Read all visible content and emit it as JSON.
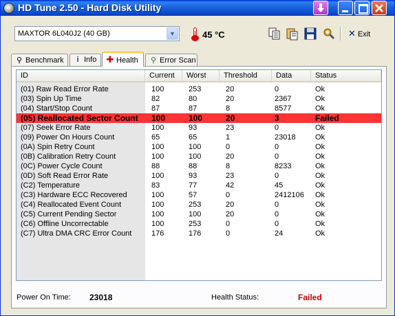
{
  "window": {
    "title": "HD Tune 2.50 - Hard Disk Utility"
  },
  "toolbar": {
    "drive": "MAXTOR 6L040J2 (40 GB)",
    "temperature": "45 °C",
    "exit_label": "Exit"
  },
  "tabs": [
    {
      "label": "Benchmark",
      "icon": "benchmark-icon"
    },
    {
      "label": "Info",
      "icon": "info-icon"
    },
    {
      "label": "Health",
      "icon": "health-cross-icon"
    },
    {
      "label": "Error Scan",
      "icon": "magnifier-icon"
    }
  ],
  "table": {
    "columns": [
      "ID",
      "Current",
      "Worst",
      "Threshold",
      "Data",
      "Status"
    ],
    "rows": [
      {
        "id": "(01) Raw Read Error Rate",
        "current": "100",
        "worst": "253",
        "threshold": "20",
        "data": "0",
        "status": "Ok"
      },
      {
        "id": "(03) Spin Up Time",
        "current": "82",
        "worst": "80",
        "threshold": "20",
        "data": "2367",
        "status": "Ok"
      },
      {
        "id": "(04) Start/Stop Count",
        "current": "87",
        "worst": "87",
        "threshold": "8",
        "data": "8577",
        "status": "Ok"
      },
      {
        "id": "(05) Reallocated Sector Count",
        "current": "100",
        "worst": "100",
        "threshold": "20",
        "data": "3",
        "status": "Failed"
      },
      {
        "id": "(07) Seek Error Rate",
        "current": "100",
        "worst": "93",
        "threshold": "23",
        "data": "0",
        "status": "Ok"
      },
      {
        "id": "(09) Power On Hours Count",
        "current": "65",
        "worst": "65",
        "threshold": "1",
        "data": "23018",
        "status": "Ok"
      },
      {
        "id": "(0A) Spin Retry Count",
        "current": "100",
        "worst": "100",
        "threshold": "0",
        "data": "0",
        "status": "Ok"
      },
      {
        "id": "(0B) Calibration Retry Count",
        "current": "100",
        "worst": "100",
        "threshold": "20",
        "data": "0",
        "status": "Ok"
      },
      {
        "id": "(0C) Power Cycle Count",
        "current": "88",
        "worst": "88",
        "threshold": "8",
        "data": "8233",
        "status": "Ok"
      },
      {
        "id": "(0D) Soft Read Error Rate",
        "current": "100",
        "worst": "93",
        "threshold": "23",
        "data": "0",
        "status": "Ok"
      },
      {
        "id": "(C2) Temperature",
        "current": "83",
        "worst": "77",
        "threshold": "42",
        "data": "45",
        "status": "Ok"
      },
      {
        "id": "(C3) Hardware ECC Recovered",
        "current": "100",
        "worst": "57",
        "threshold": "0",
        "data": "2412106",
        "status": "Ok"
      },
      {
        "id": "(C4) Reallocated Event Count",
        "current": "100",
        "worst": "253",
        "threshold": "20",
        "data": "0",
        "status": "Ok"
      },
      {
        "id": "(C5) Current Pending Sector",
        "current": "100",
        "worst": "100",
        "threshold": "20",
        "data": "0",
        "status": "Ok"
      },
      {
        "id": "(C6) Offline Uncorrectable",
        "current": "100",
        "worst": "253",
        "threshold": "0",
        "data": "0",
        "status": "Ok"
      },
      {
        "id": "(C7) Ultra DMA CRC Error Count",
        "current": "176",
        "worst": "176",
        "threshold": "0",
        "data": "24",
        "status": "Ok"
      }
    ]
  },
  "footer": {
    "power_on_label": "Power On Time:",
    "power_on_value": "23018",
    "health_label": "Health Status:",
    "health_value": "Failed"
  },
  "colors": {
    "failed_row": "#ff3333",
    "failed_text": "#cc0000",
    "titlebar": "#0a4fcf"
  }
}
